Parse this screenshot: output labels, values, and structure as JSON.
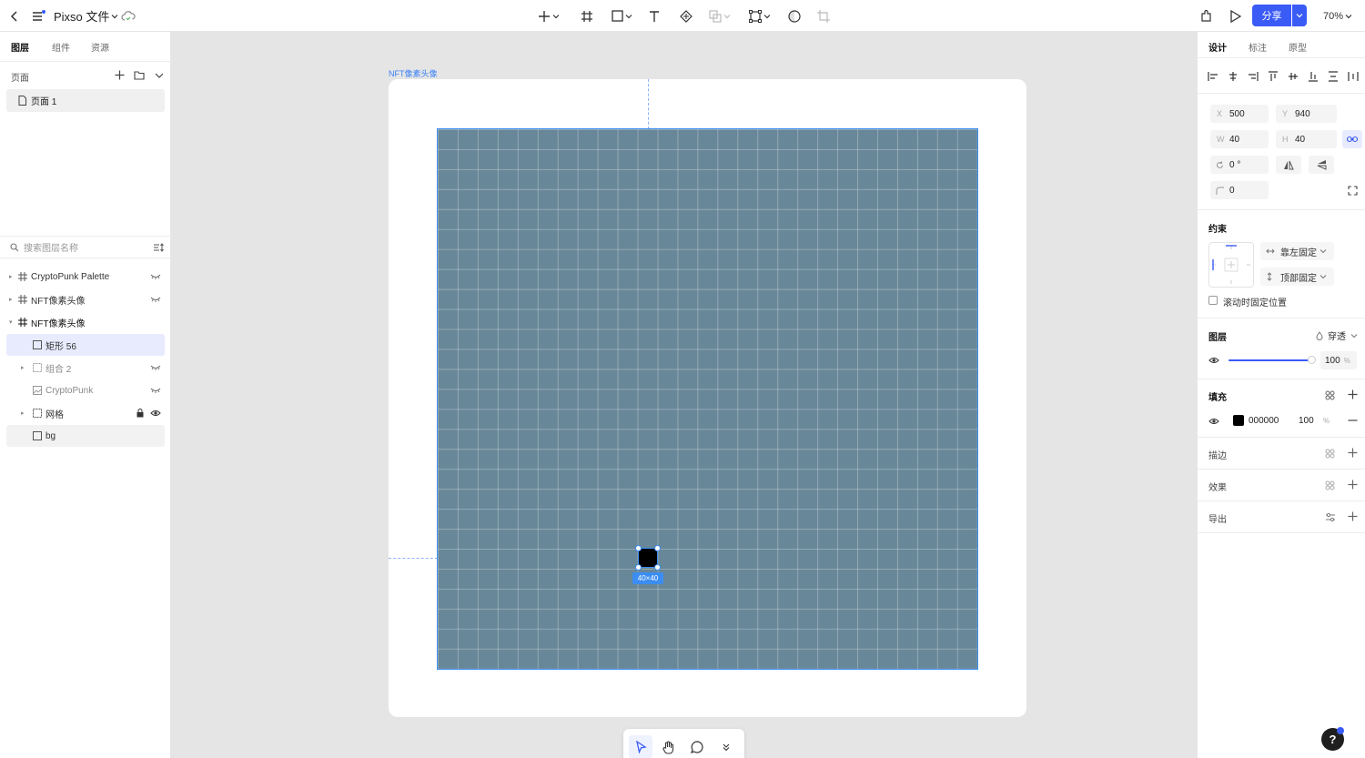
{
  "topbar": {
    "file_name": "Pixso 文件",
    "share_label": "分享",
    "zoom": "70%"
  },
  "left_panel": {
    "tabs": [
      "图层",
      "组件",
      "资源"
    ],
    "pages_header": "页面",
    "pages": [
      "页面 1"
    ],
    "search_placeholder": "搜索图层名称",
    "layers": [
      "CryptoPunk Palette",
      "NFT像素头像",
      "NFT像素头像",
      "矩形 56",
      "组合 2",
      "CryptoPunk",
      "网格",
      "bg"
    ]
  },
  "canvas": {
    "frame_label": "NFT像素头像",
    "selection_size": "40×40",
    "grid_color": "#688798"
  },
  "right_panel": {
    "tabs": [
      "设计",
      "标注",
      "原型"
    ],
    "x_label": "X",
    "x_value": "500",
    "y_label": "Y",
    "y_value": "940",
    "w_label": "W",
    "w_value": "40",
    "h_label": "H",
    "h_value": "40",
    "rotation": "0 °",
    "radius": "0",
    "constraints_title": "约束",
    "constraint_h": "靠左固定",
    "constraint_v": "顶部固定",
    "fixed_scroll_label": "滚动时固定位置",
    "layer_title": "图层",
    "blend_mode": "穿透",
    "opacity": "100",
    "percent": "%",
    "fill_title": "填充",
    "fill_hex": "000000",
    "fill_opacity": "100",
    "stroke_title": "描边",
    "effects_title": "效果",
    "export_title": "导出"
  },
  "colors": {
    "accent": "#3b5bf6",
    "selection": "#3b8df2",
    "fill_swatch": "#000000"
  }
}
